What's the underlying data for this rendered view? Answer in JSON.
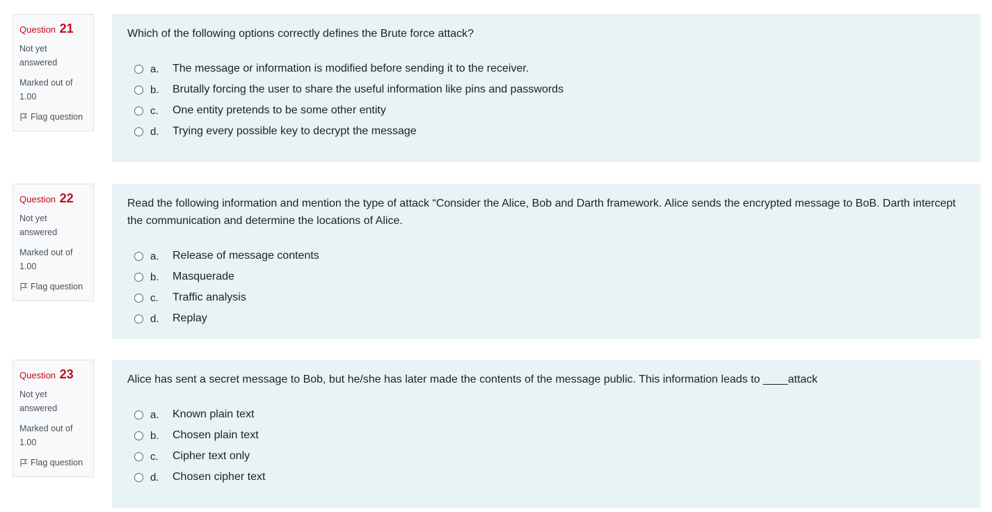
{
  "questions": [
    {
      "label": "Question",
      "number": "21",
      "state_line1": "Not yet",
      "state_line2": "answered",
      "grade_line1": "Marked out of",
      "grade_line2": "1.00",
      "flag_label": "Flag question",
      "text": "Which of the following options correctly defines the Brute force attack?",
      "options": [
        {
          "letter": "a.",
          "text": "The message or information is modified before sending it to the receiver."
        },
        {
          "letter": "b.",
          "text": "Brutally forcing the user to share the useful information like pins and passwords"
        },
        {
          "letter": "c.",
          "text": "One entity pretends to be some other entity"
        },
        {
          "letter": "d.",
          "text": "Trying every possible key to decrypt the message"
        }
      ]
    },
    {
      "label": "Question",
      "number": "22",
      "state_line1": "Not yet",
      "state_line2": "answered",
      "grade_line1": "Marked out of",
      "grade_line2": "1.00",
      "flag_label": "Flag question",
      "text": "Read the following information and mention the type of attack “Consider the Alice, Bob and Darth framework. Alice sends the encrypted message to BoB. Darth intercept the communication and determine the locations of Alice.",
      "options": [
        {
          "letter": "a.",
          "text": "Release of message contents"
        },
        {
          "letter": "b.",
          "text": "Masquerade"
        },
        {
          "letter": "c.",
          "text": "Traffic analysis"
        },
        {
          "letter": "d.",
          "text": "Replay"
        }
      ]
    },
    {
      "label": "Question",
      "number": "23",
      "state_line1": "Not yet",
      "state_line2": "answered",
      "grade_line1": "Marked out of",
      "grade_line2": "1.00",
      "flag_label": "Flag question",
      "text": "Alice has sent a secret message to Bob, but he/she has later made the contents of the message public. This information leads to ____attack",
      "options": [
        {
          "letter": "a.",
          "text": "Known plain text"
        },
        {
          "letter": "b.",
          "text": "Chosen plain text"
        },
        {
          "letter": "c.",
          "text": "Cipher text only"
        },
        {
          "letter": "d.",
          "text": "Chosen cipher text"
        }
      ]
    }
  ]
}
